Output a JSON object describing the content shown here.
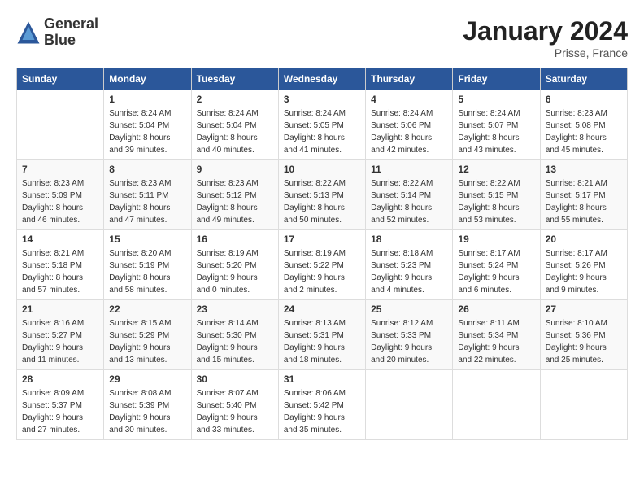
{
  "header": {
    "logo_line1": "General",
    "logo_line2": "Blue",
    "title": "January 2024",
    "subtitle": "Prisse, France"
  },
  "days_of_week": [
    "Sunday",
    "Monday",
    "Tuesday",
    "Wednesday",
    "Thursday",
    "Friday",
    "Saturday"
  ],
  "weeks": [
    [
      {
        "day": "",
        "sunrise": "",
        "sunset": "",
        "daylight": ""
      },
      {
        "day": "1",
        "sunrise": "Sunrise: 8:24 AM",
        "sunset": "Sunset: 5:04 PM",
        "daylight": "Daylight: 8 hours and 39 minutes."
      },
      {
        "day": "2",
        "sunrise": "Sunrise: 8:24 AM",
        "sunset": "Sunset: 5:04 PM",
        "daylight": "Daylight: 8 hours and 40 minutes."
      },
      {
        "day": "3",
        "sunrise": "Sunrise: 8:24 AM",
        "sunset": "Sunset: 5:05 PM",
        "daylight": "Daylight: 8 hours and 41 minutes."
      },
      {
        "day": "4",
        "sunrise": "Sunrise: 8:24 AM",
        "sunset": "Sunset: 5:06 PM",
        "daylight": "Daylight: 8 hours and 42 minutes."
      },
      {
        "day": "5",
        "sunrise": "Sunrise: 8:24 AM",
        "sunset": "Sunset: 5:07 PM",
        "daylight": "Daylight: 8 hours and 43 minutes."
      },
      {
        "day": "6",
        "sunrise": "Sunrise: 8:23 AM",
        "sunset": "Sunset: 5:08 PM",
        "daylight": "Daylight: 8 hours and 45 minutes."
      }
    ],
    [
      {
        "day": "7",
        "sunrise": "Sunrise: 8:23 AM",
        "sunset": "Sunset: 5:09 PM",
        "daylight": "Daylight: 8 hours and 46 minutes."
      },
      {
        "day": "8",
        "sunrise": "Sunrise: 8:23 AM",
        "sunset": "Sunset: 5:11 PM",
        "daylight": "Daylight: 8 hours and 47 minutes."
      },
      {
        "day": "9",
        "sunrise": "Sunrise: 8:23 AM",
        "sunset": "Sunset: 5:12 PM",
        "daylight": "Daylight: 8 hours and 49 minutes."
      },
      {
        "day": "10",
        "sunrise": "Sunrise: 8:22 AM",
        "sunset": "Sunset: 5:13 PM",
        "daylight": "Daylight: 8 hours and 50 minutes."
      },
      {
        "day": "11",
        "sunrise": "Sunrise: 8:22 AM",
        "sunset": "Sunset: 5:14 PM",
        "daylight": "Daylight: 8 hours and 52 minutes."
      },
      {
        "day": "12",
        "sunrise": "Sunrise: 8:22 AM",
        "sunset": "Sunset: 5:15 PM",
        "daylight": "Daylight: 8 hours and 53 minutes."
      },
      {
        "day": "13",
        "sunrise": "Sunrise: 8:21 AM",
        "sunset": "Sunset: 5:17 PM",
        "daylight": "Daylight: 8 hours and 55 minutes."
      }
    ],
    [
      {
        "day": "14",
        "sunrise": "Sunrise: 8:21 AM",
        "sunset": "Sunset: 5:18 PM",
        "daylight": "Daylight: 8 hours and 57 minutes."
      },
      {
        "day": "15",
        "sunrise": "Sunrise: 8:20 AM",
        "sunset": "Sunset: 5:19 PM",
        "daylight": "Daylight: 8 hours and 58 minutes."
      },
      {
        "day": "16",
        "sunrise": "Sunrise: 8:19 AM",
        "sunset": "Sunset: 5:20 PM",
        "daylight": "Daylight: 9 hours and 0 minutes."
      },
      {
        "day": "17",
        "sunrise": "Sunrise: 8:19 AM",
        "sunset": "Sunset: 5:22 PM",
        "daylight": "Daylight: 9 hours and 2 minutes."
      },
      {
        "day": "18",
        "sunrise": "Sunrise: 8:18 AM",
        "sunset": "Sunset: 5:23 PM",
        "daylight": "Daylight: 9 hours and 4 minutes."
      },
      {
        "day": "19",
        "sunrise": "Sunrise: 8:17 AM",
        "sunset": "Sunset: 5:24 PM",
        "daylight": "Daylight: 9 hours and 6 minutes."
      },
      {
        "day": "20",
        "sunrise": "Sunrise: 8:17 AM",
        "sunset": "Sunset: 5:26 PM",
        "daylight": "Daylight: 9 hours and 9 minutes."
      }
    ],
    [
      {
        "day": "21",
        "sunrise": "Sunrise: 8:16 AM",
        "sunset": "Sunset: 5:27 PM",
        "daylight": "Daylight: 9 hours and 11 minutes."
      },
      {
        "day": "22",
        "sunrise": "Sunrise: 8:15 AM",
        "sunset": "Sunset: 5:29 PM",
        "daylight": "Daylight: 9 hours and 13 minutes."
      },
      {
        "day": "23",
        "sunrise": "Sunrise: 8:14 AM",
        "sunset": "Sunset: 5:30 PM",
        "daylight": "Daylight: 9 hours and 15 minutes."
      },
      {
        "day": "24",
        "sunrise": "Sunrise: 8:13 AM",
        "sunset": "Sunset: 5:31 PM",
        "daylight": "Daylight: 9 hours and 18 minutes."
      },
      {
        "day": "25",
        "sunrise": "Sunrise: 8:12 AM",
        "sunset": "Sunset: 5:33 PM",
        "daylight": "Daylight: 9 hours and 20 minutes."
      },
      {
        "day": "26",
        "sunrise": "Sunrise: 8:11 AM",
        "sunset": "Sunset: 5:34 PM",
        "daylight": "Daylight: 9 hours and 22 minutes."
      },
      {
        "day": "27",
        "sunrise": "Sunrise: 8:10 AM",
        "sunset": "Sunset: 5:36 PM",
        "daylight": "Daylight: 9 hours and 25 minutes."
      }
    ],
    [
      {
        "day": "28",
        "sunrise": "Sunrise: 8:09 AM",
        "sunset": "Sunset: 5:37 PM",
        "daylight": "Daylight: 9 hours and 27 minutes."
      },
      {
        "day": "29",
        "sunrise": "Sunrise: 8:08 AM",
        "sunset": "Sunset: 5:39 PM",
        "daylight": "Daylight: 9 hours and 30 minutes."
      },
      {
        "day": "30",
        "sunrise": "Sunrise: 8:07 AM",
        "sunset": "Sunset: 5:40 PM",
        "daylight": "Daylight: 9 hours and 33 minutes."
      },
      {
        "day": "31",
        "sunrise": "Sunrise: 8:06 AM",
        "sunset": "Sunset: 5:42 PM",
        "daylight": "Daylight: 9 hours and 35 minutes."
      },
      {
        "day": "",
        "sunrise": "",
        "sunset": "",
        "daylight": ""
      },
      {
        "day": "",
        "sunrise": "",
        "sunset": "",
        "daylight": ""
      },
      {
        "day": "",
        "sunrise": "",
        "sunset": "",
        "daylight": ""
      }
    ]
  ]
}
